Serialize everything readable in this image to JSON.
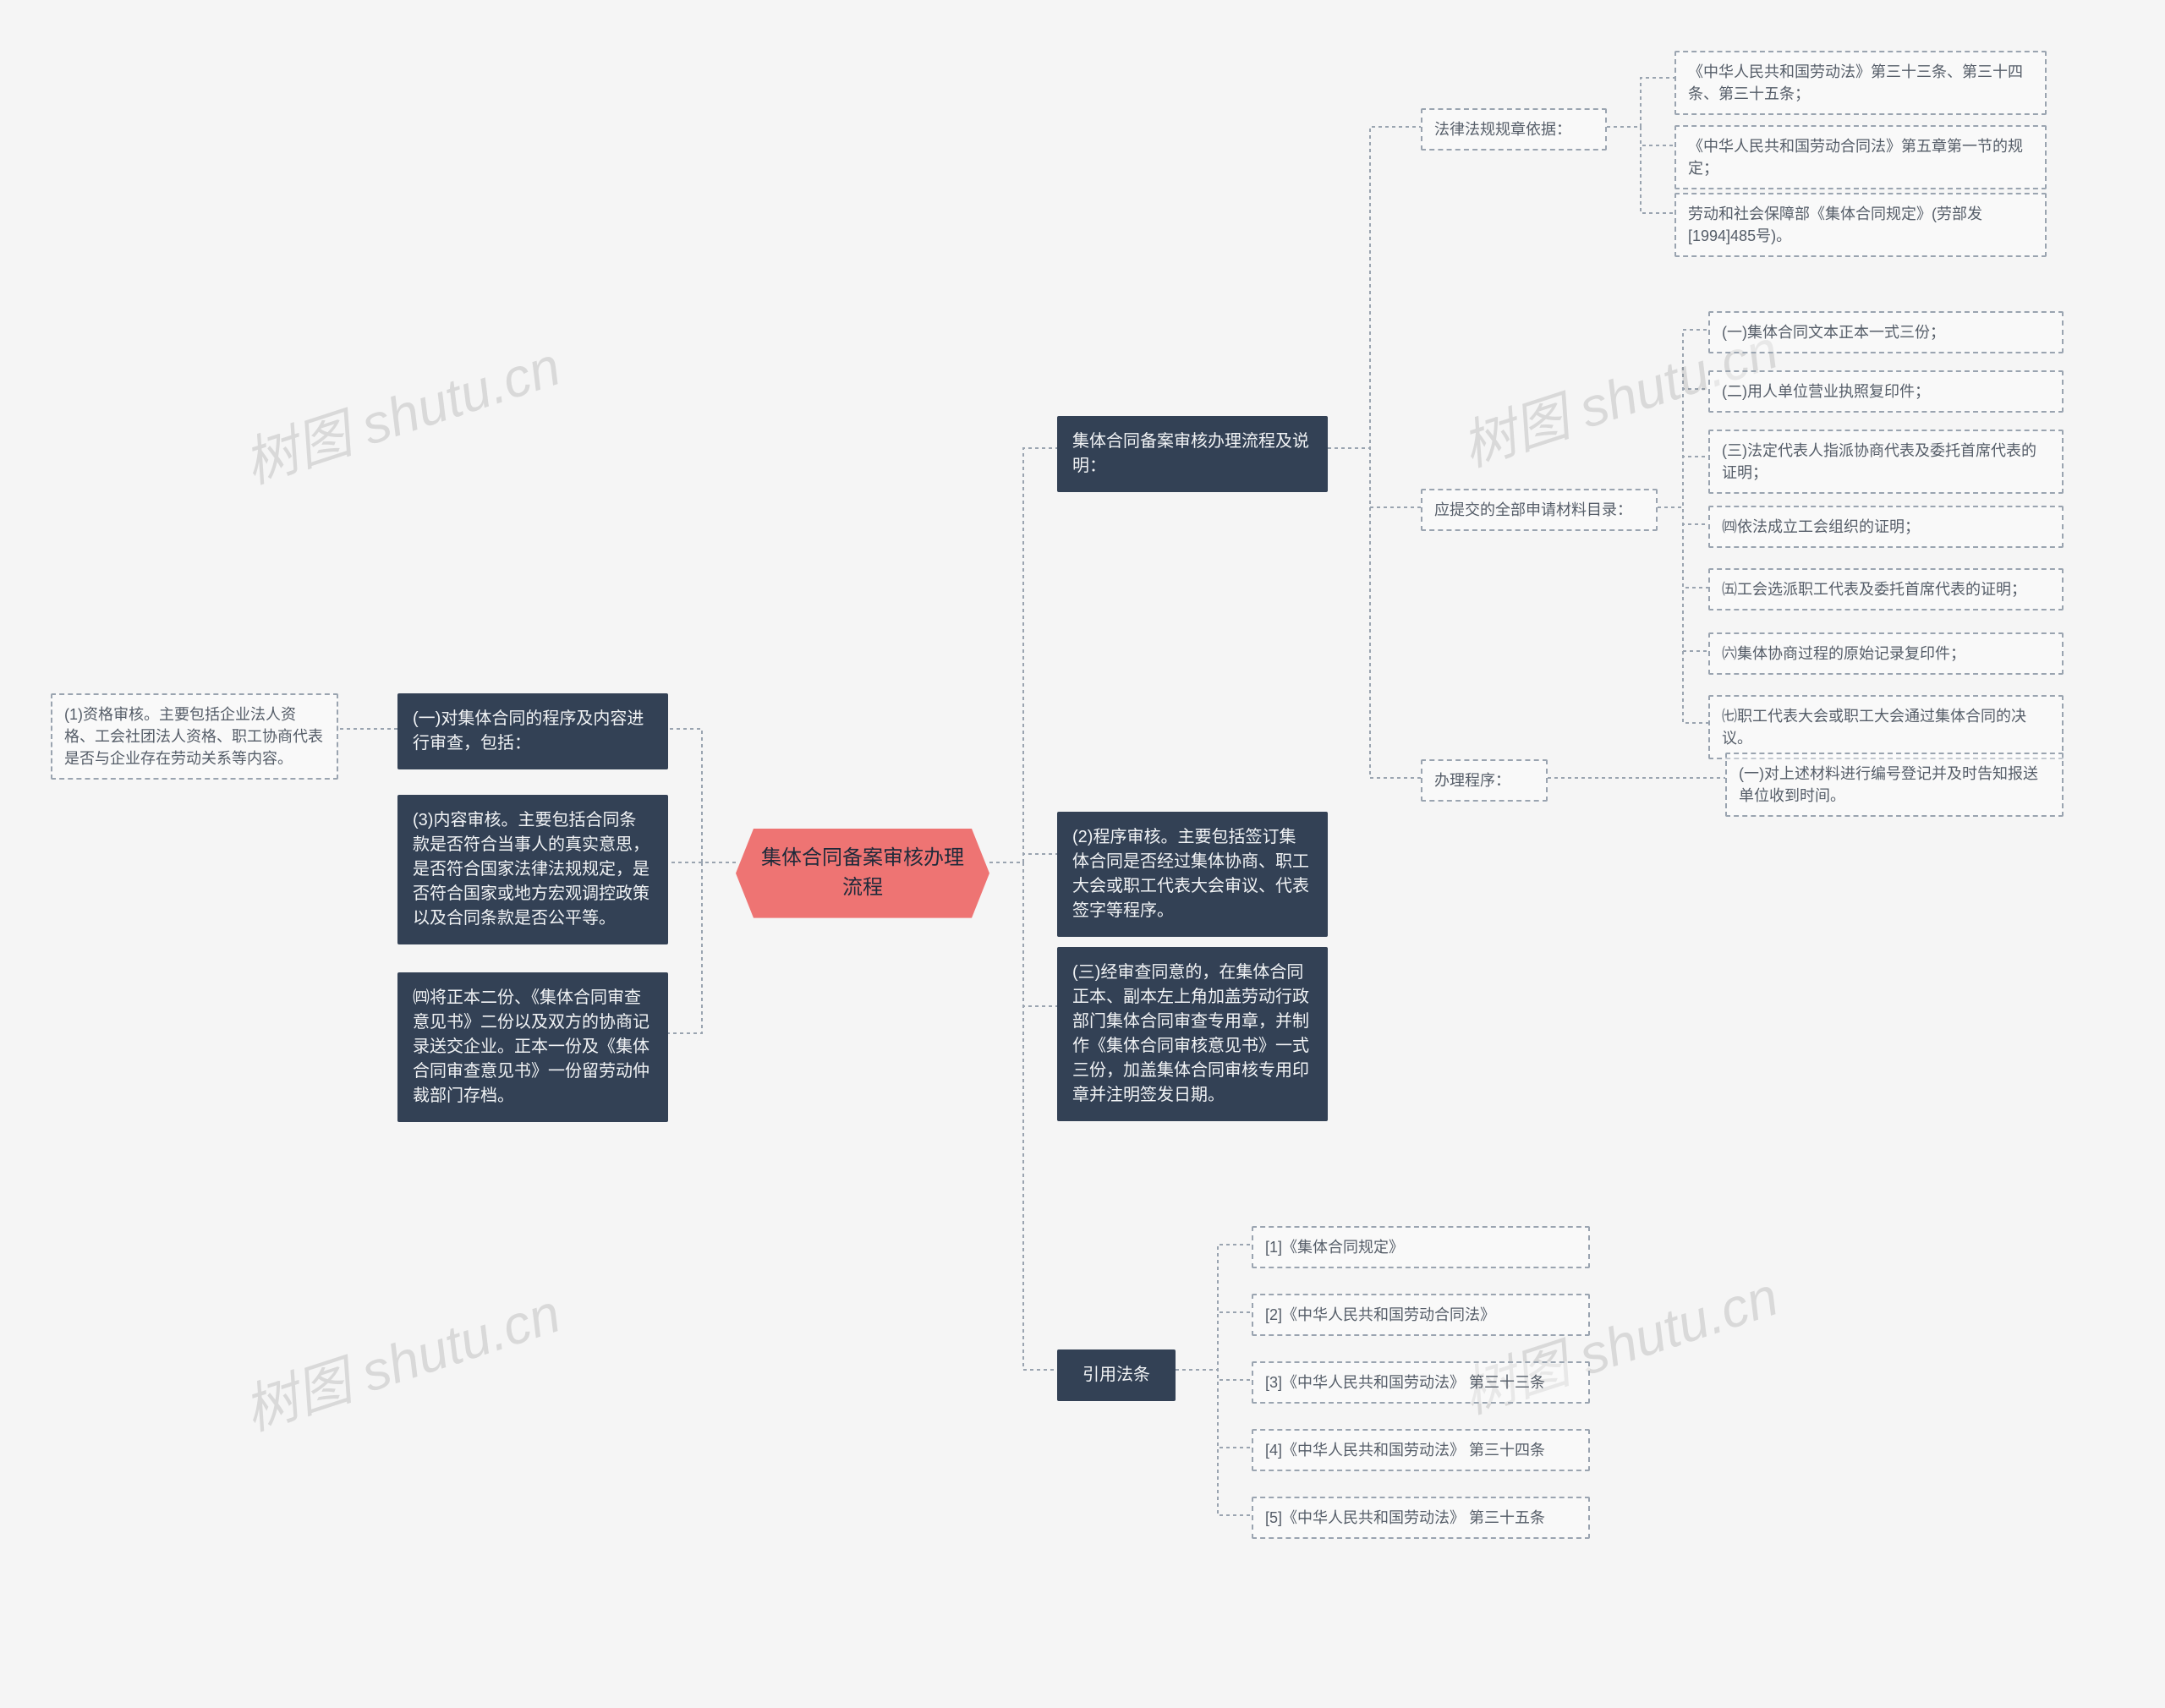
{
  "watermark": "树图 shutu.cn",
  "root": "集体合同备案审核办理流程",
  "left": {
    "b1": "(一)对集体合同的程序及内容进行审查，包括：",
    "b1_leaf": "(1)资格审核。主要包括企业法人资格、工会社团法人资格、职工协商代表是否与企业存在劳动关系等内容。",
    "b2": "(3)内容审核。主要包括合同条款是否符合当事人的真实意思，是否符合国家法律法规规定，是否符合国家或地方宏观调控政策以及合同条款是否公平等。",
    "b3": "㈣将正本二份、《集体合同审查意见书》二份以及双方的协商记录送交企业。正本一份及《集体合同审查意见书》一份留劳动仲裁部门存档。"
  },
  "right": {
    "r1": "集体合同备案审核办理流程及说明：",
    "r1_law_label": "法律法规规章依据：",
    "r1_laws": [
      "《中华人民共和国劳动法》第三十三条、第三十四条、第三十五条；",
      "《中华人民共和国劳动合同法》第五章第一节的规定；",
      "劳动和社会保障部《集体合同规定》(劳部发[1994]485号)。"
    ],
    "r1_mat_label": "应提交的全部申请材料目录：",
    "r1_mats": [
      "(一)集体合同文本正本一式三份；",
      "(二)用人单位营业执照复印件；",
      "(三)法定代表人指派协商代表及委托首席代表的证明；",
      "㈣依法成立工会组织的证明；",
      "㈤工会选派职工代表及委托首席代表的证明；",
      "㈥集体协商过程的原始记录复印件；",
      "㈦职工代表大会或职工大会通过集体合同的决议。"
    ],
    "r1_proc_label": "办理程序：",
    "r1_proc_item": "(一)对上述材料进行编号登记并及时告知报送单位收到时间。",
    "r2": "(2)程序审核。主要包括签订集体合同是否经过集体协商、职工大会或职工代表大会审议、代表签字等程序。",
    "r3": "(三)经审查同意的，在集体合同正本、副本左上角加盖劳动行政部门集体合同审查专用章，并制作《集体合同审核意见书》一式三份，加盖集体合同审核专用印章并注明签发日期。",
    "r4": "引用法条",
    "r4_items": [
      "[1]《集体合同规定》",
      "[2]《中华人民共和国劳动合同法》",
      "[3]《中华人民共和国劳动法》 第三十三条",
      "[4]《中华人民共和国劳动法》 第三十四条",
      "[5]《中华人民共和国劳动法》 第三十五条"
    ]
  }
}
